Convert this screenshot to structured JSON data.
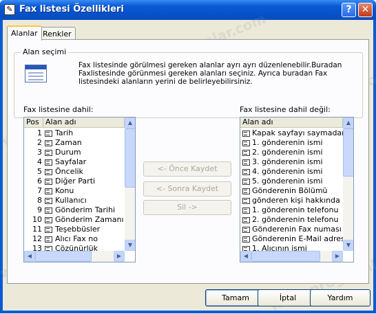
{
  "window": {
    "title": "Fax listesi Özellikleri",
    "help_label": "?",
    "close_label": "✕"
  },
  "tabs": [
    {
      "label": "Alanlar",
      "active": true
    },
    {
      "label": "Renkler",
      "active": false
    }
  ],
  "group": {
    "legend": "Alan seçimi",
    "description": "Fax listesinde görülmesi gereken alanlar ayrı ayrı düzenlenebilir.Buradan Faxlistesinde görünmesi gereken alanları seçiniz. Ayrıca buradan Fax listesindeki alanların yerini de belirleyebilirsiniz."
  },
  "included": {
    "label": "Fax listesine dahil:",
    "columns": [
      "Pos",
      "Alan adı"
    ],
    "rows": [
      {
        "pos": "1",
        "name": "Tarih"
      },
      {
        "pos": "2",
        "name": "Zaman"
      },
      {
        "pos": "3",
        "name": "Durum"
      },
      {
        "pos": "4",
        "name": "Sayfalar"
      },
      {
        "pos": "5",
        "name": "Öncelik"
      },
      {
        "pos": "6",
        "name": "Diğer Parti"
      },
      {
        "pos": "7",
        "name": "Konu"
      },
      {
        "pos": "8",
        "name": "Kullanıcı"
      },
      {
        "pos": "9",
        "name": "Gönderim Tarihi"
      },
      {
        "pos": "10",
        "name": "Gönderim Zamanı"
      },
      {
        "pos": "11",
        "name": "Teşebbüsler"
      },
      {
        "pos": "12",
        "name": "Alıcı Fax no"
      },
      {
        "pos": "13",
        "name": "Çözünürlük"
      }
    ]
  },
  "excluded": {
    "label": "Fax listesine dahil değil:",
    "columns": [
      "Alan adı"
    ],
    "rows": [
      "Kapak sayfayı saymadan d",
      "1. gönderenin ismi",
      "2. gönderenin ismi",
      "3. gönderenin ismi",
      "4. gönderenin ismi",
      "5. gönderenin ismi",
      "Gönderenin Bölümü",
      "gönderen kişi hakkında",
      "1. gönderenin telefonu",
      "2. gönderenin telefonu",
      "Gönderenin  Fax numası",
      "Gönderenin E-Mail adresi",
      "1. Alıcının ismi"
    ]
  },
  "move_buttons": {
    "up": "<- Önce Kaydet",
    "down": "<- Sonra Kaydet",
    "delete": "Sil ->"
  },
  "footer": {
    "ok": "Tamam",
    "cancel": "İptal",
    "help": "Yardım"
  },
  "watermark": "www.programlar.com",
  "icons": {
    "app": "fax-icon",
    "field": "field-icon",
    "info": "list-window-icon"
  }
}
